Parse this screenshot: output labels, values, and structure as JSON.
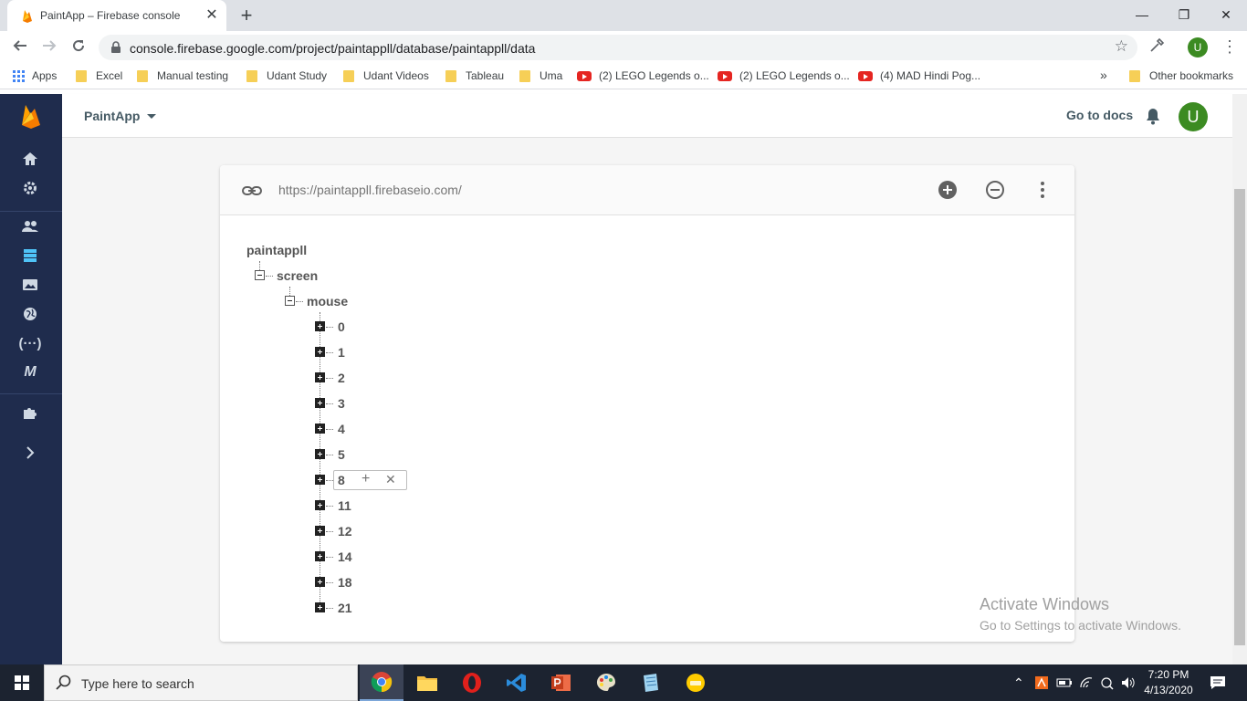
{
  "browser": {
    "tab_title": "PaintApp – Firebase console",
    "tab_close": "✕",
    "new_tab": "+",
    "url": "console.firebase.google.com/project/paintappll/database/paintappll/data",
    "profile_initial": "U",
    "window_controls": {
      "minimize": "—",
      "maximize": "❐",
      "close": "✕"
    }
  },
  "bookmarks": [
    {
      "label": "Apps",
      "type": "apps"
    },
    {
      "label": "Excel",
      "type": "folder"
    },
    {
      "label": "Manual testing",
      "type": "folder"
    },
    {
      "label": "Udant Study",
      "type": "folder"
    },
    {
      "label": "Udant Videos",
      "type": "folder"
    },
    {
      "label": "Tableau",
      "type": "folder"
    },
    {
      "label": "Uma",
      "type": "folder"
    },
    {
      "label": "(2) LEGO Legends o...",
      "type": "youtube"
    },
    {
      "label": "(2) LEGO Legends o...",
      "type": "youtube"
    },
    {
      "label": "(4) MAD Hindi Pog...",
      "type": "youtube"
    }
  ],
  "bookmarks_overflow": "»",
  "other_bookmarks": "Other bookmarks",
  "firebase": {
    "project_name": "PaintApp",
    "go_to_docs": "Go to docs",
    "user_initial": "U",
    "sidebar_icons": [
      "home-icon",
      "settings-icon",
      "users-icon",
      "database-icon",
      "storage-icon",
      "hosting-icon",
      "functions-icon",
      "ml-kit-icon",
      "extensions-icon",
      "expand-icon"
    ],
    "accent_color": "#ffa000",
    "sidebar_color": "#1f2c4d"
  },
  "database": {
    "url": "https://paintappll.firebaseio.com/",
    "root": "paintappll",
    "level1": "screen",
    "level2": "mouse",
    "children": [
      "0",
      "1",
      "2",
      "3",
      "4",
      "5",
      "8",
      "11",
      "12",
      "14",
      "18",
      "21"
    ],
    "hovered_child": "8",
    "hover_add": "+",
    "hover_remove": "✕"
  },
  "watermark": {
    "line1": "Activate Windows",
    "line2": "Go to Settings to activate Windows."
  },
  "taskbar": {
    "search_placeholder": "Type here to search",
    "time": "7:20 PM",
    "date": "4/13/2020",
    "tray_chevron": "⌃"
  }
}
